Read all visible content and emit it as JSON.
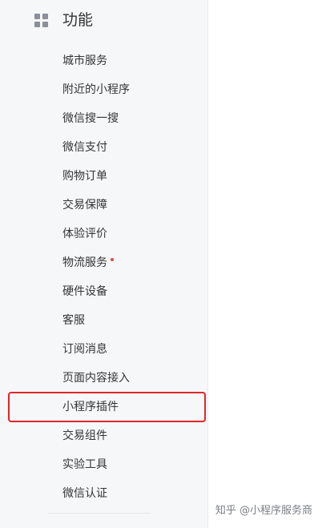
{
  "section": {
    "title": "功能",
    "icon": "grid-icon"
  },
  "menu": {
    "items": [
      {
        "label": "城市服务"
      },
      {
        "label": "附近的小程序"
      },
      {
        "label": "微信搜一搜"
      },
      {
        "label": "微信支付"
      },
      {
        "label": "购物订单"
      },
      {
        "label": "交易保障"
      },
      {
        "label": "体验评价"
      },
      {
        "label": "物流服务",
        "badge": "dot"
      },
      {
        "label": "硬件设备"
      },
      {
        "label": "客服"
      },
      {
        "label": "订阅消息"
      },
      {
        "label": "页面内容接入"
      },
      {
        "label": "小程序插件",
        "highlighted": true
      },
      {
        "label": "交易组件"
      },
      {
        "label": "实验工具"
      },
      {
        "label": "微信认证"
      }
    ]
  },
  "watermark": "知乎 @小程序服务商",
  "colors": {
    "highlight_border": "#e0262a",
    "badge_dot": "#e64340",
    "sidebar_bg": "#f6f7f9"
  }
}
